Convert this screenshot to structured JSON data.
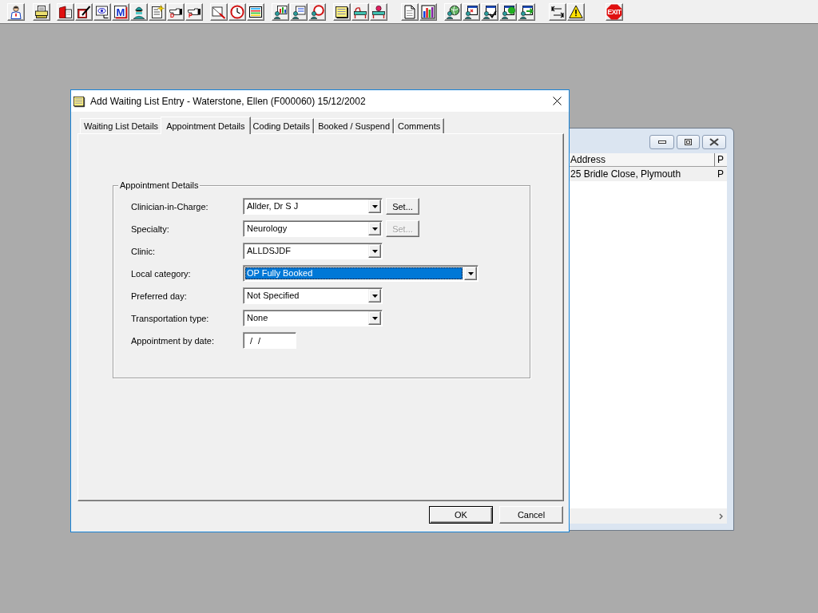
{
  "toolbar": [
    [
      {
        "kind": "doctor"
      }
    ],
    [
      {
        "kind": "printer"
      }
    ],
    [
      {
        "kind": "book"
      },
      {
        "kind": "notepad"
      },
      {
        "kind": "scan"
      },
      {
        "kind": "letter",
        "label": "M"
      },
      {
        "kind": "surgeon"
      },
      {
        "kind": "memo"
      },
      {
        "kind": "hand",
        "label": "D"
      },
      {
        "kind": "hand",
        "label": "P"
      }
    ],
    [
      {
        "kind": "edit"
      },
      {
        "kind": "clock"
      },
      {
        "kind": "screen"
      }
    ],
    [
      {
        "kind": "chart"
      },
      {
        "kind": "form"
      },
      {
        "kind": "alarm"
      }
    ],
    [
      {
        "kind": "note"
      },
      {
        "kind": "bed"
      },
      {
        "kind": "patient"
      }
    ],
    [
      {
        "kind": "page"
      },
      {
        "kind": "stats"
      }
    ],
    [
      {
        "kind": "globe"
      },
      {
        "kind": "card"
      },
      {
        "kind": "check"
      },
      {
        "kind": "add"
      },
      {
        "kind": "transfer"
      }
    ],
    [
      {
        "kind": "swap"
      },
      {
        "kind": "warning"
      }
    ],
    [
      {
        "kind": "exit",
        "label": "EXIT"
      }
    ]
  ],
  "background_window": {
    "columns": [
      "Address",
      "P"
    ],
    "rows": [
      {
        "cells": [
          "25 Bridle Close, Plymouth",
          "P"
        ],
        "selected": true
      }
    ]
  },
  "dialog": {
    "title": "Add Waiting List Entry - Waterstone, Ellen (F000060) 15/12/2002",
    "tabs": [
      {
        "label": "Waiting List Details",
        "selected": false
      },
      {
        "label": "Appointment Details",
        "selected": true
      },
      {
        "label": "Coding Details",
        "selected": false
      },
      {
        "label": "Booked / Suspend",
        "selected": false
      },
      {
        "label": "Comments",
        "selected": false
      }
    ],
    "group": {
      "title": "Appointment Details",
      "fields": [
        {
          "kind": "combo",
          "label": "Clinician-in-Charge:",
          "value": "Allder, Dr S J",
          "highlighted": false,
          "set_button": {
            "label": "Set...",
            "disabled": false
          }
        },
        {
          "kind": "combo",
          "label": "Specialty:",
          "value": "Neurology",
          "highlighted": false,
          "set_button": {
            "label": "Set...",
            "disabled": true
          }
        },
        {
          "kind": "combo",
          "label": "Clinic:",
          "value": "ALLDSJDF",
          "highlighted": false
        },
        {
          "kind": "widecombo",
          "label": "Local category:",
          "value": "OP Fully Booked",
          "highlighted": true
        },
        {
          "kind": "combo",
          "label": "Preferred day:",
          "value": "Not Specified",
          "highlighted": false
        },
        {
          "kind": "combo",
          "label": "Transportation type:",
          "value": "None",
          "highlighted": false
        },
        {
          "kind": "date",
          "label": "Appointment by date:",
          "value": "/ /"
        }
      ]
    },
    "buttons": [
      {
        "label": "OK",
        "default": true
      },
      {
        "label": "Cancel",
        "default": false
      }
    ]
  }
}
